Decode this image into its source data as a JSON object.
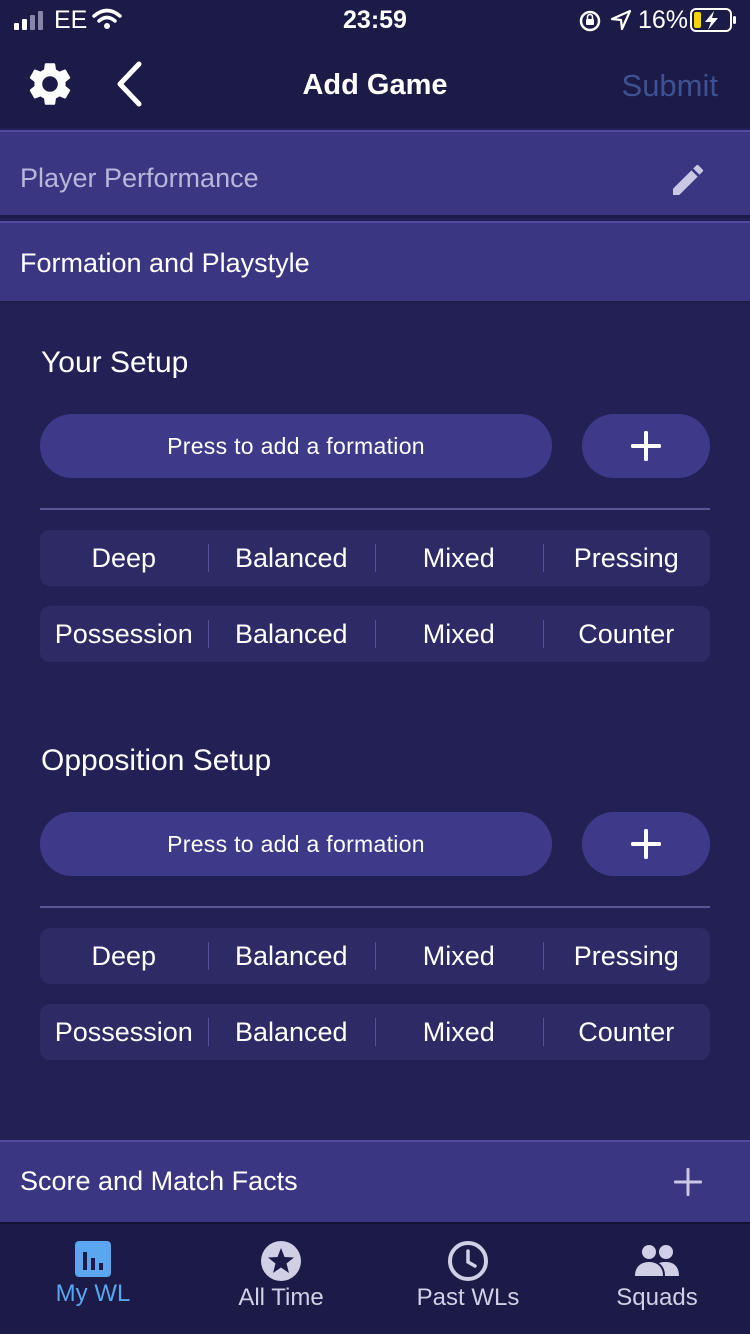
{
  "status_bar": {
    "carrier": "EE",
    "time": "23:59",
    "battery_percent": "16%"
  },
  "nav": {
    "title": "Add Game",
    "submit_label": "Submit"
  },
  "sections": {
    "player_performance": "Player Performance",
    "formation_playstyle": "Formation and Playstyle",
    "score_match_facts": "Score and Match Facts"
  },
  "your_setup": {
    "title": "Your Setup",
    "formation_button": "Press to add a formation",
    "row1": [
      "Deep",
      "Balanced",
      "Mixed",
      "Pressing"
    ],
    "row2": [
      "Possession",
      "Balanced",
      "Mixed",
      "Counter"
    ]
  },
  "opposition_setup": {
    "title": "Opposition Setup",
    "formation_button": "Press to add a formation",
    "row1": [
      "Deep",
      "Balanced",
      "Mixed",
      "Pressing"
    ],
    "row2": [
      "Possession",
      "Balanced",
      "Mixed",
      "Counter"
    ]
  },
  "tabs": [
    {
      "label": "My WL",
      "icon": "bar-chart-icon",
      "active": true
    },
    {
      "label": "All Time",
      "icon": "star-icon",
      "active": false
    },
    {
      "label": "Past WLs",
      "icon": "clock-icon",
      "active": false
    },
    {
      "label": "Squads",
      "icon": "people-icon",
      "active": false
    }
  ],
  "colors": {
    "background": "#232055",
    "bar": "#1c1a47",
    "section": "#3a3682",
    "button": "#3e3a8a",
    "active_tab": "#5aa6f0",
    "submit_disabled": "#3e5192"
  }
}
